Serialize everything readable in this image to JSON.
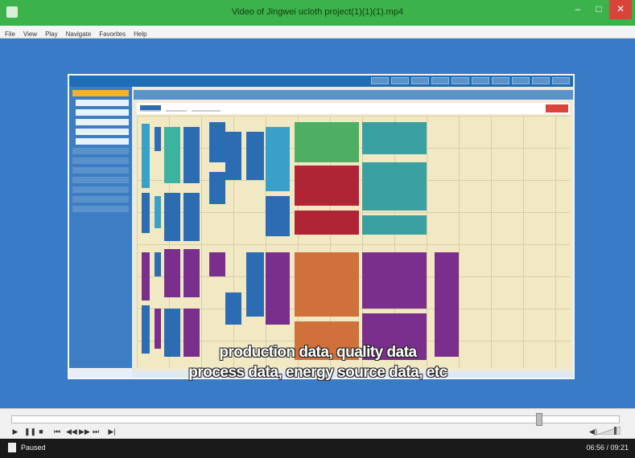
{
  "window": {
    "title": "Video of Jingwei ucloth project(1)(1)(1).mp4",
    "minimize_glyph": "–",
    "maximize_glyph": "□",
    "close_glyph": "✕"
  },
  "menu": {
    "items": [
      {
        "label": "File"
      },
      {
        "label": "View"
      },
      {
        "label": "Play"
      },
      {
        "label": "Navigate"
      },
      {
        "label": "Favorites"
      },
      {
        "label": "Help"
      }
    ]
  },
  "video": {
    "subtitle_line1": "production data, quality data",
    "subtitle_line2": "process data, energy source data, etc",
    "progress_fraction": 0.87
  },
  "controls": {
    "play_glyph": "▶",
    "pause_glyph": "❚❚",
    "stop_glyph": "■",
    "prev_glyph": "⏮",
    "rew_glyph": "◀◀",
    "fwd_glyph": "▶▶",
    "next_glyph": "⏭",
    "step_glyph": "▶|",
    "vol_glyph": "◀)"
  },
  "status": {
    "state": "Paused",
    "time": "06:56 / 09:21"
  },
  "colors": {
    "titlebar": "#3bb34a",
    "close": "#d9433a",
    "desktop": "#3a7bc8"
  }
}
